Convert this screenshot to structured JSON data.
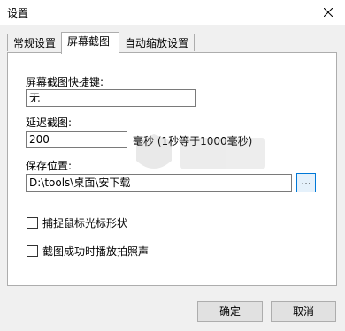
{
  "window": {
    "title": "设置"
  },
  "tabs": [
    {
      "label": "常规设置",
      "active": false
    },
    {
      "label": "屏幕截图",
      "active": true
    },
    {
      "label": "自动缩放设置",
      "active": false
    }
  ],
  "screenshot": {
    "hotkey_label": "屏幕截图快捷键:",
    "hotkey_value": "无",
    "delay_label": "延迟截图:",
    "delay_value": "200",
    "delay_unit": "毫秒 (1秒等于1000毫秒)",
    "save_label": "保存位置:",
    "save_path": "D:\\tools\\桌面\\安下载",
    "browse_label": "...",
    "capture_cursor_label": "捕捉鼠标光标形状",
    "capture_cursor_checked": false,
    "play_sound_label": "截图成功时播放拍照声",
    "play_sound_checked": false
  },
  "footer": {
    "ok_label": "确定",
    "cancel_label": "取消"
  },
  "colors": {
    "accent": "#0078d7",
    "panel_bg": "#ffffff",
    "dialog_bg": "#f0f0f0"
  },
  "icons": {
    "close": "close-icon"
  }
}
